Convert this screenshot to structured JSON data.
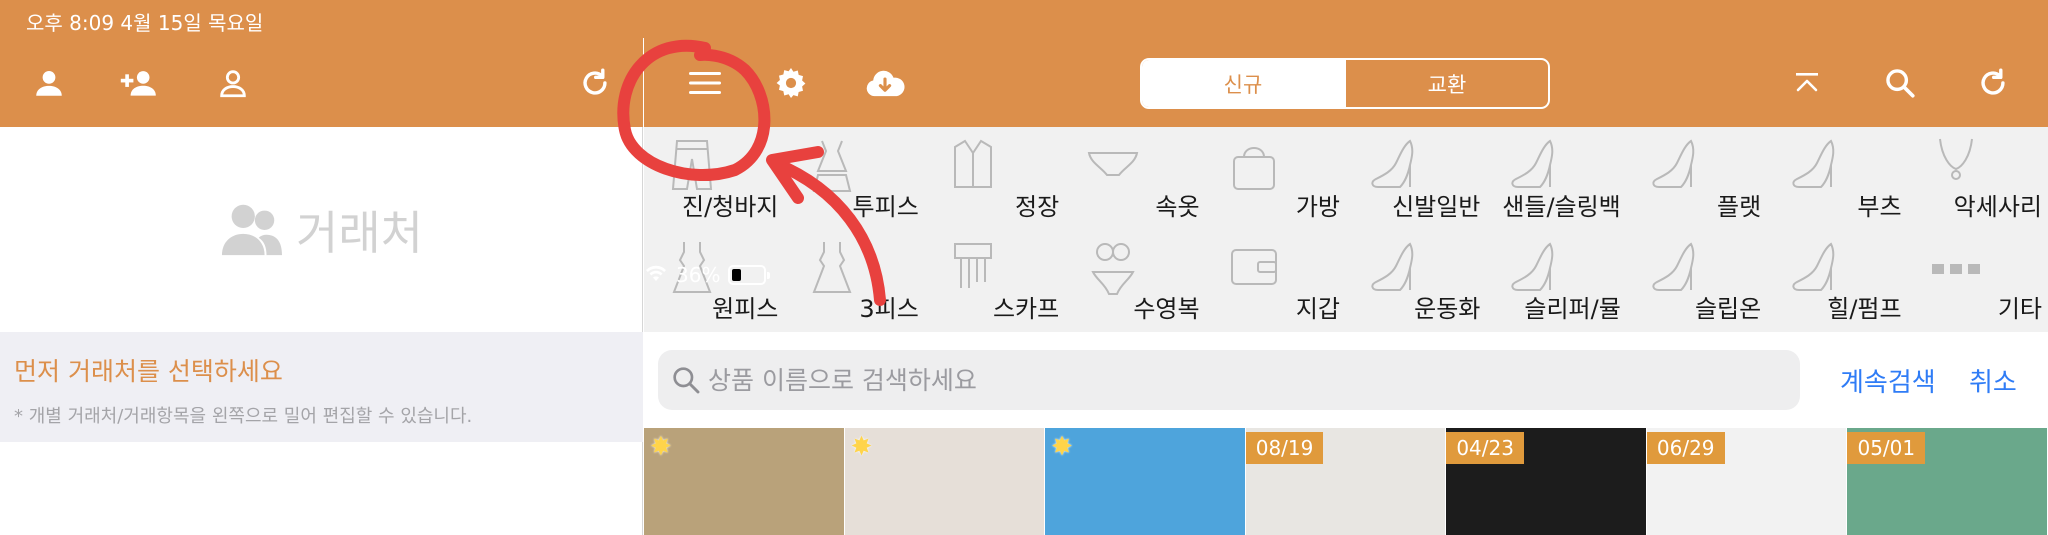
{
  "status": {
    "time": "오후 8:09   4월 15일 목요일",
    "battery": "36%",
    "battery_fraction": 0.36
  },
  "left_panel": {
    "nav_icons": [
      "person-icon",
      "person-add-icon",
      "person-outline-icon",
      "refresh-icon"
    ],
    "placeholder_label": "거래처",
    "notice_title": "먼저 거래처를 선택하세요",
    "notice_hint": "* 개별 거래처/거래항목을 왼쪽으로 밀어 편집할 수 있습니다."
  },
  "right_panel": {
    "nav_icons": [
      "menu-icon",
      "gear-icon",
      "cloud-download-icon",
      "collapse-up-icon",
      "search-icon",
      "refresh-icon"
    ],
    "segments": [
      {
        "label": "신규",
        "selected": true
      },
      {
        "label": "교환",
        "selected": false
      }
    ],
    "categories": [
      {
        "label": "진/청바지",
        "icon": "jeans-icon"
      },
      {
        "label": "투피스",
        "icon": "two-piece-icon"
      },
      {
        "label": "정장",
        "icon": "suit-icon"
      },
      {
        "label": "속옷",
        "icon": "underwear-icon"
      },
      {
        "label": "가방",
        "icon": "bag-icon"
      },
      {
        "label": "신발일반",
        "icon": "shoe-icon"
      },
      {
        "label": "샌들/슬링백",
        "icon": "shoe-icon"
      },
      {
        "label": "플랫",
        "icon": "shoe-icon"
      },
      {
        "label": "부츠",
        "icon": "shoe-icon"
      },
      {
        "label": "악세사리",
        "icon": "necklace-icon"
      },
      {
        "label": "원피스",
        "icon": "dress-icon"
      },
      {
        "label": "3피스",
        "icon": "dress-icon"
      },
      {
        "label": "스카프",
        "icon": "scarf-icon"
      },
      {
        "label": "수영복",
        "icon": "swimsuit-icon"
      },
      {
        "label": "지갑",
        "icon": "wallet-icon"
      },
      {
        "label": "운동화",
        "icon": "shoe-icon"
      },
      {
        "label": "슬리퍼/뮬",
        "icon": "shoe-icon"
      },
      {
        "label": "슬립온",
        "icon": "shoe-icon"
      },
      {
        "label": "힐/펌프",
        "icon": "shoe-icon"
      },
      {
        "label": "기타",
        "icon": "more-icon"
      }
    ],
    "search_placeholder": "상품 이름으로 검색하세요",
    "continue_search": "계속검색",
    "cancel": "취소",
    "thumbnails": [
      {
        "badge": "",
        "star": true,
        "color": "#b9a27a"
      },
      {
        "badge": "",
        "star": true,
        "color": "#e6dfd8"
      },
      {
        "badge": "",
        "star": true,
        "color": "#4ea4dc"
      },
      {
        "badge": "08/19",
        "star": false,
        "color": "#e8e6e2"
      },
      {
        "badge": "04/23",
        "star": false,
        "color": "#1c1c1c"
      },
      {
        "badge": "06/29",
        "star": false,
        "color": "#f2f2f2"
      },
      {
        "badge": "05/01",
        "star": false,
        "color": "#6aa88b"
      }
    ]
  },
  "colors": {
    "accent": "#DC8F4B",
    "link": "#2F7CF6",
    "annotation": "#E8413E"
  }
}
